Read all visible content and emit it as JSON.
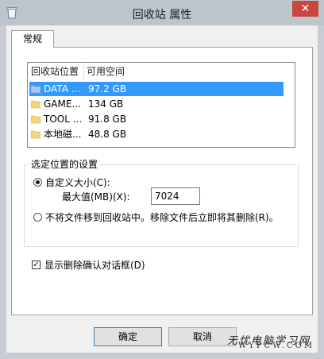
{
  "window": {
    "title": "回收站 属性",
    "close_glyph": "✕"
  },
  "tabs": [
    {
      "label": "常规",
      "selected": true
    }
  ],
  "list": {
    "headers": [
      "回收站位置",
      "可用空间"
    ],
    "rows": [
      {
        "name": "DATA ...",
        "space": "97.2 GB",
        "selected": true
      },
      {
        "name": "GAME...",
        "space": "134 GB",
        "selected": false
      },
      {
        "name": "TOOL ...",
        "space": "91.8 GB",
        "selected": false
      },
      {
        "name": "本地磁...",
        "space": "48.8 GB",
        "selected": false
      }
    ]
  },
  "settings": {
    "group_label": "选定位置的设置",
    "custom_size_label": "自定义大小(C):",
    "custom_size_selected": true,
    "max_size_label": "最大值(MB)(X):",
    "max_size_value": "7024",
    "no_recycle_label": "不将文件移到回收站中。移除文件后立即将其删除(R)。",
    "no_recycle_selected": false
  },
  "confirm_dialog": {
    "label": "显示删除确认对话框(D)",
    "checked": true
  },
  "buttons": {
    "ok": "确定",
    "cancel": "取消"
  },
  "watermark": {
    "line1": "无忧电脑学习网",
    "line2": "WYPCW.COM"
  },
  "icons": {
    "app": "recycle-bin-icon",
    "folder": "folder-icon",
    "close": "close-icon"
  },
  "colors": {
    "selection": "#3399ff",
    "close_button": "#c7473c",
    "title_bar": "#bcc4cc"
  }
}
